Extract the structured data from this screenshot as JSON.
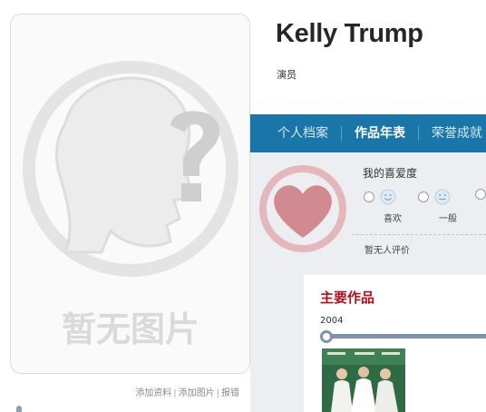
{
  "profile": {
    "name": "Kelly Trump",
    "role": "演员"
  },
  "photo": {
    "placeholder_text": "暂无图片",
    "placeholder_icon": "question-head-icon",
    "links": {
      "add_info": "添加资料",
      "add_image": "添加图片",
      "report": "报错",
      "separator": "|"
    }
  },
  "tabs": [
    {
      "label": "个人档案",
      "active": false
    },
    {
      "label": "作品年表",
      "active": true
    },
    {
      "label": "荣誉成就",
      "active": false
    }
  ],
  "rating": {
    "title": "我的喜爱度",
    "options": [
      {
        "label": "喜欢",
        "icon": "smile-icon"
      },
      {
        "label": "一般",
        "icon": "neutral-face-icon"
      },
      {
        "label": "",
        "icon": ""
      }
    ],
    "no_review_text": "暂无人评价",
    "badge_icon": "heart-icon"
  },
  "works": {
    "title": "主要作品",
    "year": "2004"
  },
  "colors": {
    "tab_bar": "#1a75a9",
    "works_title": "#b3101c",
    "heart": "#c86a72",
    "timeline": "#7e92ac"
  }
}
